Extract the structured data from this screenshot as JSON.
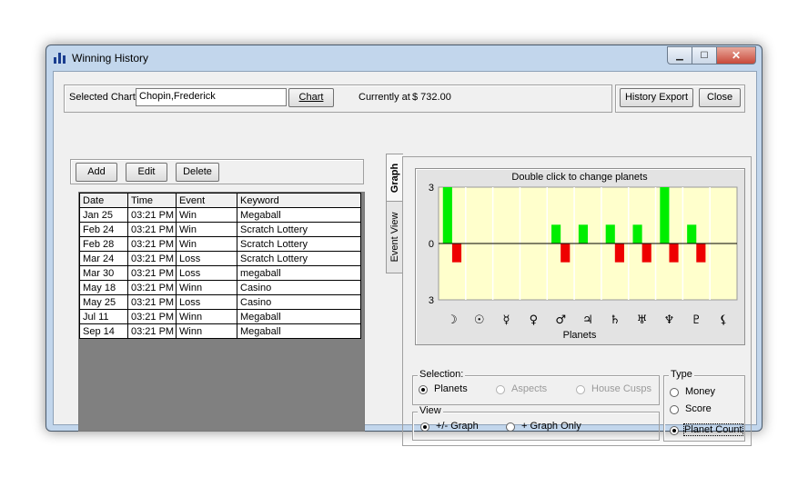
{
  "window": {
    "title": "Winning History",
    "minimize": "▁",
    "maximize": "☐",
    "close": "✕"
  },
  "top": {
    "selected_chart_label": "Selected Chart",
    "selected_chart_value": "Chopin,Frederick",
    "chart_button": "Chart",
    "currently_label": "Currently at",
    "currently_value": "$ 732.00",
    "history_export_button": "History Export",
    "close_button": "Close"
  },
  "toolbar": {
    "add": "Add",
    "edit": "Edit",
    "delete": "Delete"
  },
  "table": {
    "headers": [
      "Date",
      "Time",
      "Event",
      "Keyword"
    ],
    "rows": [
      [
        "Jan 25",
        "03:21 PM",
        "Win",
        "Megaball"
      ],
      [
        "Feb 24",
        "03:21 PM",
        "Win",
        "Scratch Lottery"
      ],
      [
        "Feb 28",
        "03:21 PM",
        "Win",
        "Scratch Lottery"
      ],
      [
        "Mar 24",
        "03:21 PM",
        "Loss",
        "Scratch Lottery"
      ],
      [
        "Mar 30",
        "03:21 PM",
        "Loss",
        "megaball"
      ],
      [
        "May 18",
        "03:21 PM",
        "Winn",
        "Casino"
      ],
      [
        "May 25",
        "03:21 PM",
        "Loss",
        "Casino"
      ],
      [
        "Jul 11",
        "03:21 PM",
        "Winn",
        "Megaball"
      ],
      [
        "Sep 14",
        "03:21 PM",
        "Winn",
        "Megaball"
      ]
    ]
  },
  "tabs": {
    "graph": "Graph",
    "event_view": "Event View"
  },
  "chart_data": {
    "type": "bar",
    "title": "Double click to change planets",
    "xlabel": "Planets",
    "ylabel": "",
    "categories": [
      "☽",
      "☉",
      "☿",
      "♀",
      "♂",
      "♃",
      "♄",
      "♅",
      "♆",
      "♇",
      "⚸"
    ],
    "y_tick_labels": [
      "3",
      "0",
      "3"
    ],
    "ylim": [
      -3,
      3
    ],
    "series": [
      {
        "color": "#00ee00",
        "values": [
          3,
          0,
          0,
          0,
          1,
          1,
          1,
          1,
          3,
          1,
          0
        ]
      },
      {
        "color": "#ee0000",
        "values": [
          -1,
          0,
          0,
          0,
          -1,
          0,
          -1,
          -1,
          -1,
          -1,
          0
        ]
      }
    ],
    "plot_background": "#ffffcc",
    "grid": true
  },
  "selection": {
    "title": "Selection:",
    "options": [
      "Planets",
      "Aspects",
      "House Cusps"
    ],
    "selected": "Planets"
  },
  "view": {
    "title": "View",
    "options": [
      "+/- Graph",
      "+ Graph Only"
    ],
    "selected": "+/- Graph"
  },
  "type_group": {
    "title": "Type",
    "options": [
      "Money",
      "Score",
      "Planet Count"
    ],
    "selected": "Planet Count"
  }
}
